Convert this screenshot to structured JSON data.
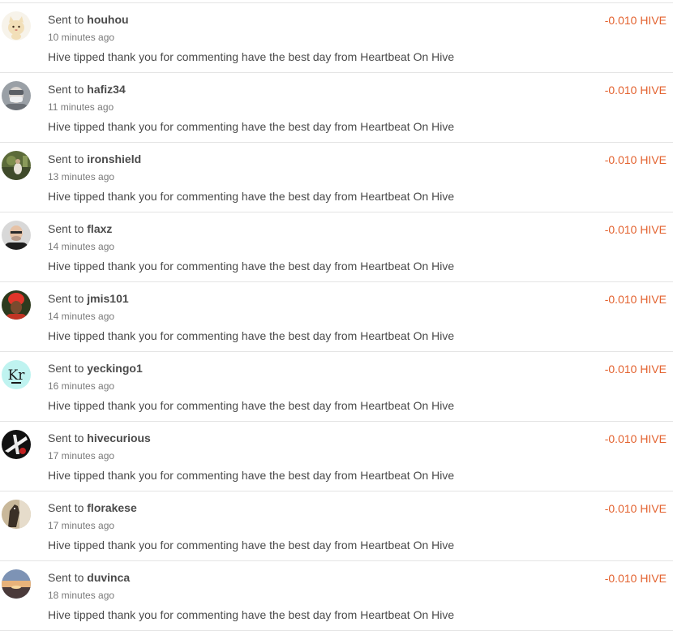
{
  "colors": {
    "amount_negative": "#e3622f",
    "divider": "#e4e4e4",
    "text": "#4a4a4a",
    "muted": "#7a7a7a"
  },
  "transfers": [
    {
      "prefix": "Sent to",
      "user": "houhou",
      "time": "10 minutes ago",
      "memo": "Hive tipped thank you for commenting have the best day from Heartbeat On Hive",
      "amount": "-0.010 HIVE",
      "avatar": "cat-avatar"
    },
    {
      "prefix": "Sent to",
      "user": "hafiz34",
      "time": "11 minutes ago",
      "memo": "Hive tipped thank you for commenting have the best day from Heartbeat On Hive",
      "amount": "-0.010 HIVE",
      "avatar": "masked-person-avatar"
    },
    {
      "prefix": "Sent to",
      "user": "ironshield",
      "time": "13 minutes ago",
      "memo": "Hive tipped thank you for commenting have the best day from Heartbeat On Hive",
      "amount": "-0.010 HIVE",
      "avatar": "outdoor-avatar"
    },
    {
      "prefix": "Sent to",
      "user": "flaxz",
      "time": "14 minutes ago",
      "memo": "Hive tipped thank you for commenting have the best day from Heartbeat On Hive",
      "amount": "-0.010 HIVE",
      "avatar": "bald-man-avatar"
    },
    {
      "prefix": "Sent to",
      "user": "jmis101",
      "time": "14 minutes ago",
      "memo": "Hive tipped thank you for commenting have the best day from Heartbeat On Hive",
      "amount": "-0.010 HIVE",
      "avatar": "red-headwrap-avatar"
    },
    {
      "prefix": "Sent to",
      "user": "yeckingo1",
      "time": "16 minutes ago",
      "memo": "Hive tipped thank you for commenting have the best day from Heartbeat On Hive",
      "amount": "-0.010 HIVE",
      "avatar": "kr-logo-avatar",
      "avatar_text": "Kr"
    },
    {
      "prefix": "Sent to",
      "user": "hivecurious",
      "time": "17 minutes ago",
      "memo": "Hive tipped thank you for commenting have the best day from Heartbeat On Hive",
      "amount": "-0.010 HIVE",
      "avatar": "black-white-symbol-avatar"
    },
    {
      "prefix": "Sent to",
      "user": "florakese",
      "time": "17 minutes ago",
      "memo": "Hive tipped thank you for commenting have the best day from Heartbeat On Hive",
      "amount": "-0.010 HIVE",
      "avatar": "horse-avatar"
    },
    {
      "prefix": "Sent to",
      "user": "duvinca",
      "time": "18 minutes ago",
      "memo": "Hive tipped thank you for commenting have the best day from Heartbeat On Hive",
      "amount": "-0.010 HIVE",
      "avatar": "sunset-avatar"
    }
  ]
}
